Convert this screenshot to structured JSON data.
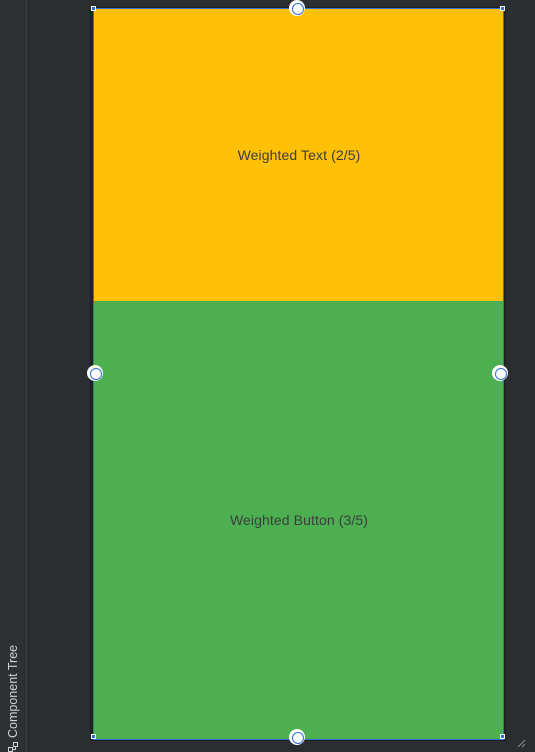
{
  "component_tree_tab": {
    "label": "Component Tree",
    "icon": "component-tree-icon"
  },
  "preview": {
    "weighted_text": {
      "text": "Weighted Text (2/5)",
      "background": "#ffc107"
    },
    "weighted_button": {
      "text": "Weighted Button (3/5)",
      "background": "#4caf50"
    },
    "selection_color": "#2f6fd8"
  }
}
